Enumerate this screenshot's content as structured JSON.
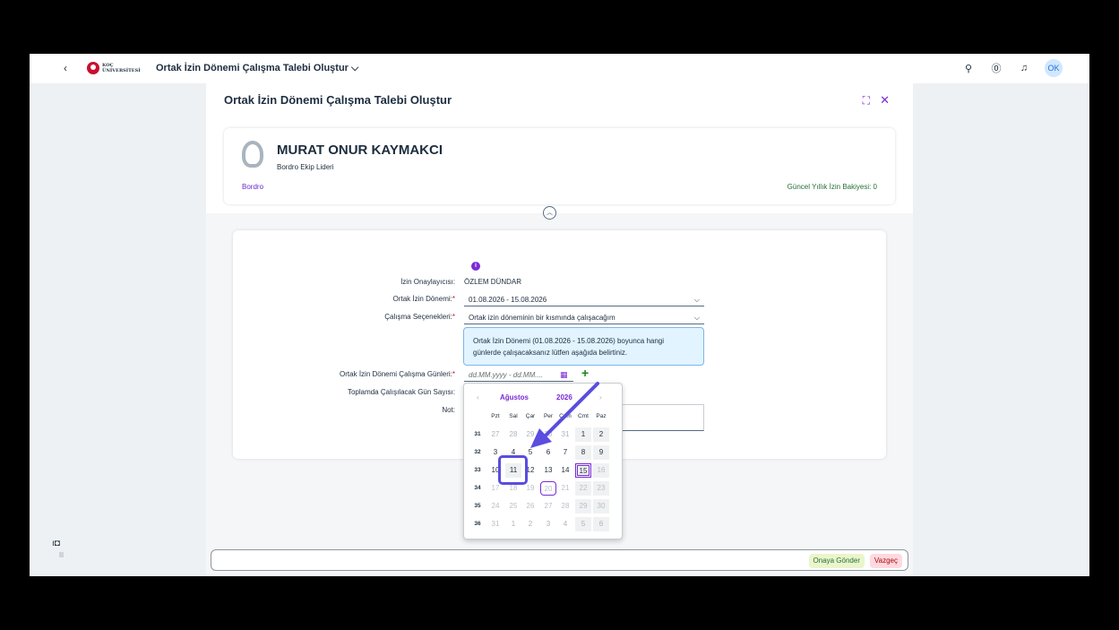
{
  "shell": {
    "back": "‹",
    "logo_line1": "KOÇ",
    "logo_line2": "ÜNİVERSİTESİ",
    "title": "Ortak İzin Dönemi Çalışma Talebi Oluştur ⌵",
    "avatar": "OK",
    "icons": [
      "search-icon",
      "help-icon",
      "bell-icon"
    ]
  },
  "header": {
    "title": "Ortak İzin Dönemi Çalışma Talebi Oluştur",
    "employee": {
      "name": "MURAT ONUR KAYMAKCI",
      "role": "Bordro Ekip Lideri",
      "department": "Bordro",
      "balance": "Güncel Yıllık İzin Bakiyesi: 0"
    }
  },
  "form": {
    "approver_label": "İzin Onaylayıcısı:",
    "approver_value": "ÖZLEM DÜNDAR",
    "period_label": "Ortak İzin Dönemi:",
    "period_value": "01.08.2026 - 15.08.2026",
    "option_label": "Çalışma Seçenekleri:",
    "option_value": "Ortak izin döneminin bir kısmında çalışacağım",
    "info_text_1": "Ortak İzin Dönemi (01.08.2026 - 15.08.2026) boyunca hangi",
    "info_text_2": "günlerde çalışacaksanız lütfen aşağıda belirtiniz.",
    "days_label": "Ortak İzin Dönemi Çalışma Günleri:",
    "days_placeholder": "dd.MM.yyyy - dd.MM....",
    "total_label": "Toplamda Çalışılacak Gün Sayısı:",
    "note_label": "Not:"
  },
  "calendar": {
    "month": "Ağustos",
    "year": "2026",
    "days_of_week": [
      "Pzt",
      "Sal",
      "Çar",
      "Per",
      "Cum",
      "Cmt",
      "Paz"
    ],
    "weeks": [
      {
        "week": "31",
        "days": [
          "27",
          "28",
          "29",
          "30",
          "31",
          "1",
          "2"
        ]
      },
      {
        "week": "32",
        "days": [
          "3",
          "4",
          "5",
          "6",
          "7",
          "8",
          "9"
        ]
      },
      {
        "week": "33",
        "days": [
          "10",
          "11",
          "12",
          "13",
          "14",
          "15",
          "16"
        ]
      },
      {
        "week": "34",
        "days": [
          "17",
          "18",
          "19",
          "20",
          "21",
          "22",
          "23"
        ]
      },
      {
        "week": "35",
        "days": [
          "24",
          "25",
          "26",
          "27",
          "28",
          "29",
          "30"
        ]
      },
      {
        "week": "36",
        "days": [
          "31",
          "1",
          "2",
          "3",
          "4",
          "5",
          "6"
        ]
      }
    ],
    "highlighted_day": "11",
    "today_day": "20"
  },
  "footer": {
    "submit": "Onaya Gönder",
    "cancel": "Vazgeç"
  },
  "colors": {
    "accent": "#7a2bd6",
    "arrow": "#5a4de0",
    "positive": "#256f3a",
    "negative": "#aa0808"
  }
}
